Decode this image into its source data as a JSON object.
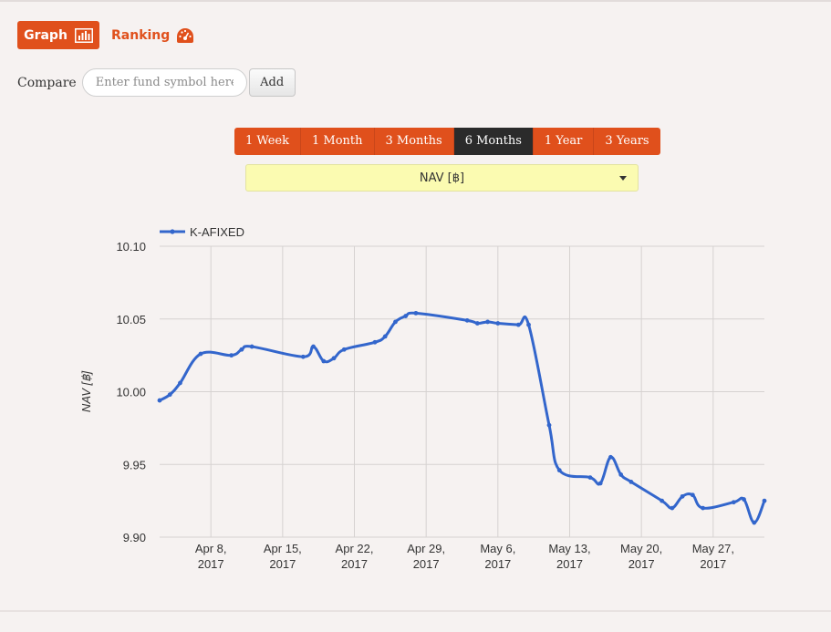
{
  "toolbar": {
    "graph_label": "Graph",
    "ranking_label": "Ranking",
    "compare_label": "Compare",
    "compare_placeholder": "Enter fund symbol here",
    "add_label": "Add"
  },
  "range_tabs": [
    {
      "label": "1 Week",
      "active": false
    },
    {
      "label": "1 Month",
      "active": false
    },
    {
      "label": "3 Months",
      "active": false
    },
    {
      "label": "6 Months",
      "active": true
    },
    {
      "label": "1 Year",
      "active": false
    },
    {
      "label": "3 Years",
      "active": false
    }
  ],
  "metric_select": {
    "selected": "NAV [฿]"
  },
  "colors": {
    "accent": "#e0501c",
    "active_tab": "#2b2b2b",
    "select_bg": "#fbfbb1",
    "series": "#3366cc"
  },
  "chart_data": {
    "type": "line",
    "ylabel": "NAV [฿]",
    "ylim": [
      9.9,
      10.1
    ],
    "yticks": [
      "10.10",
      "10.05",
      "10.00",
      "9.95",
      "9.90"
    ],
    "xticks": [
      {
        "date": "2017-04-08",
        "label": [
          "Apr 8,",
          "2017"
        ]
      },
      {
        "date": "2017-04-15",
        "label": [
          "Apr 15,",
          "2017"
        ]
      },
      {
        "date": "2017-04-22",
        "label": [
          "Apr 22,",
          "2017"
        ]
      },
      {
        "date": "2017-04-29",
        "label": [
          "Apr 29,",
          "2017"
        ]
      },
      {
        "date": "2017-05-06",
        "label": [
          "May 6,",
          "2017"
        ]
      },
      {
        "date": "2017-05-13",
        "label": [
          "May 13,",
          "2017"
        ]
      },
      {
        "date": "2017-05-20",
        "label": [
          "May 20,",
          "2017"
        ]
      },
      {
        "date": "2017-05-27",
        "label": [
          "May 27,",
          "2017"
        ]
      }
    ],
    "xlim": [
      "2017-04-03",
      "2017-06-01"
    ],
    "grid": true,
    "legend_position": "top-left",
    "series": [
      {
        "name": "K-AFIXED",
        "points": [
          [
            "2017-04-03",
            9.994
          ],
          [
            "2017-04-04",
            9.998
          ],
          [
            "2017-04-05",
            10.006
          ],
          [
            "2017-04-07",
            10.026
          ],
          [
            "2017-04-10",
            10.025
          ],
          [
            "2017-04-11",
            10.029
          ],
          [
            "2017-04-12",
            10.031
          ],
          [
            "2017-04-17",
            10.024
          ],
          [
            "2017-04-18",
            10.031
          ],
          [
            "2017-04-19",
            10.021
          ],
          [
            "2017-04-20",
            10.023
          ],
          [
            "2017-04-21",
            10.029
          ],
          [
            "2017-04-24",
            10.034
          ],
          [
            "2017-04-25",
            10.038
          ],
          [
            "2017-04-26",
            10.048
          ],
          [
            "2017-04-27",
            10.052
          ],
          [
            "2017-04-28",
            10.054
          ],
          [
            "2017-05-03",
            10.049
          ],
          [
            "2017-05-04",
            10.047
          ],
          [
            "2017-05-05",
            10.048
          ],
          [
            "2017-05-06",
            10.047
          ],
          [
            "2017-05-08",
            10.046
          ],
          [
            "2017-05-09",
            10.046
          ],
          [
            "2017-05-11",
            9.977
          ],
          [
            "2017-05-12",
            9.946
          ],
          [
            "2017-05-15",
            9.941
          ],
          [
            "2017-05-16",
            9.937
          ],
          [
            "2017-05-17",
            9.955
          ],
          [
            "2017-05-18",
            9.943
          ],
          [
            "2017-05-19",
            9.938
          ],
          [
            "2017-05-22",
            9.925
          ],
          [
            "2017-05-23",
            9.92
          ],
          [
            "2017-05-24",
            9.928
          ],
          [
            "2017-05-25",
            9.929
          ],
          [
            "2017-05-26",
            9.92
          ],
          [
            "2017-05-29",
            9.924
          ],
          [
            "2017-05-30",
            9.926
          ],
          [
            "2017-05-31",
            9.91
          ],
          [
            "2017-06-01",
            9.925
          ]
        ]
      }
    ]
  }
}
